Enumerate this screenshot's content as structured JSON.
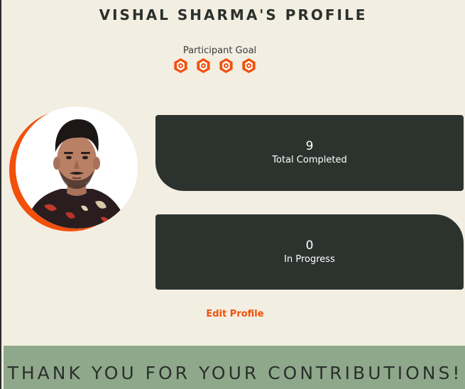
{
  "profile": {
    "title": "VISHAL SHARMA'S PROFILE"
  },
  "goal": {
    "label": "Participant Goal",
    "icons": [
      "badge-icon",
      "badge-icon",
      "badge-icon",
      "badge-icon"
    ],
    "icon_color": "#f2500b"
  },
  "avatar": {
    "accent_color": "#f2500b"
  },
  "stats": {
    "completed": {
      "value": "9",
      "label": "Total Completed"
    },
    "in_progress": {
      "value": "0",
      "label": "In Progress"
    }
  },
  "actions": {
    "edit_label": "Edit Profile"
  },
  "footer": {
    "message": "THANK YOU FOR YOUR CONTRIBUTIONS!"
  },
  "colors": {
    "background": "#f2eee2",
    "card": "#2c332f",
    "accent": "#f2500b",
    "footer": "#8fa88b"
  }
}
